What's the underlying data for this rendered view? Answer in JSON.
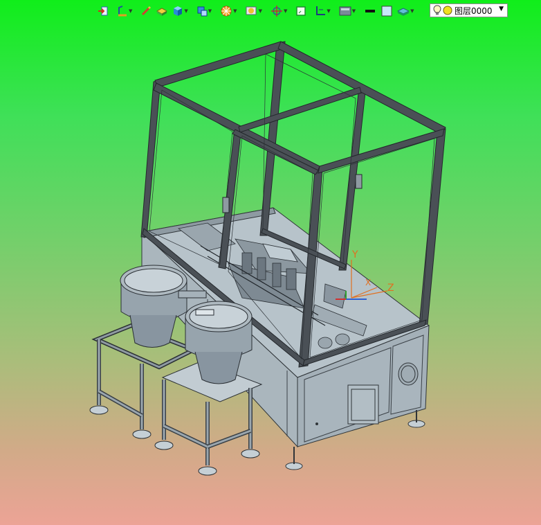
{
  "toolbar": {
    "layer_name": "图层0000",
    "icons": [
      "import-icon",
      "sketch-icon",
      "pencil-icon",
      "box-icon",
      "cube-icon",
      "view-cube-icon",
      "render-icon",
      "display-icon",
      "axis-icon",
      "frame-icon",
      "plane-icon",
      "section-icon",
      "line-color-icon",
      "fill-color-icon",
      "layer-stack-icon",
      "bulb-icon",
      "layer-color-icon"
    ]
  },
  "colors": {
    "frame": "#3a3f44",
    "body": "#b8c4cc",
    "body_dark": "#93a0aa",
    "glass_edge": "#2c3034"
  },
  "axis": {
    "x_label": "X",
    "y_label": "Y",
    "z_label": "Z"
  }
}
